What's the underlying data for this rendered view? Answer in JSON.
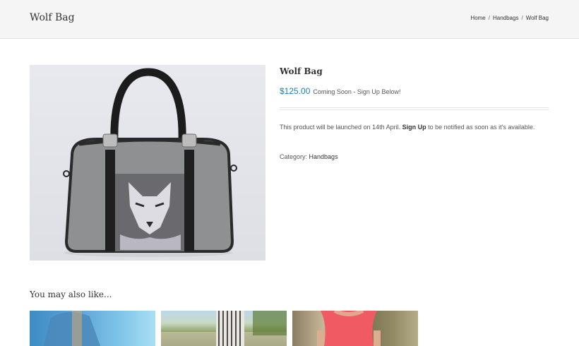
{
  "header": {
    "page_title": "Wolf Bag",
    "breadcrumb": {
      "home": "Home",
      "category": "Handbags",
      "current": "Wolf Bag",
      "separator": "/"
    }
  },
  "product": {
    "title": "Wolf Bag",
    "price": "$125.00",
    "availability": "Coming Soon - Sign Up Below!",
    "description_before": "This product will be launched on 14th April. ",
    "description_link": "Sign Up",
    "description_after": " to be notified as soon as it's available.",
    "category_label": "Category: ",
    "category_value": "Handbags"
  },
  "related": {
    "title": "You may also like..."
  },
  "colors": {
    "price": "#1e7fb8",
    "header_bg": "#f5f5f5"
  }
}
